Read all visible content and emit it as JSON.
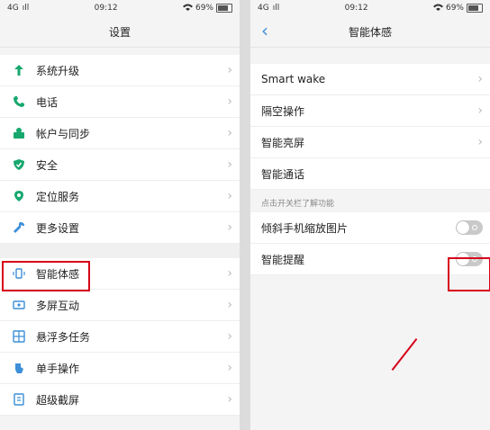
{
  "left": {
    "status": {
      "network": "4G",
      "signal": "ıll",
      "time": "09:12",
      "battery": "69%"
    },
    "title": "设置",
    "group1": [
      {
        "label": "系统升级",
        "icon": "arrow-up-icon"
      },
      {
        "label": "电话",
        "icon": "phone-icon"
      },
      {
        "label": "帐户与同步",
        "icon": "account-sync-icon"
      },
      {
        "label": "安全",
        "icon": "shield-icon"
      },
      {
        "label": "定位服务",
        "icon": "location-pin-icon"
      },
      {
        "label": "更多设置",
        "icon": "wrench-icon"
      }
    ],
    "group2": [
      {
        "label": "智能体感",
        "icon": "smart-motion-icon"
      },
      {
        "label": "多屏互动",
        "icon": "multi-screen-icon"
      },
      {
        "label": "悬浮多任务",
        "icon": "floating-task-icon"
      },
      {
        "label": "单手操作",
        "icon": "one-hand-icon"
      },
      {
        "label": "超级截屏",
        "icon": "screenshot-icon"
      }
    ]
  },
  "right": {
    "status": {
      "network": "4G",
      "signal": "ıll",
      "time": "09:12",
      "battery": "69%"
    },
    "title": "智能体感",
    "items": [
      {
        "label": "Smart wake"
      },
      {
        "label": "隔空操作"
      },
      {
        "label": "智能亮屏"
      },
      {
        "label": "智能通话"
      }
    ],
    "section_label": "点击开关栏了解功能",
    "toggles": [
      {
        "label": "倾斜手机缩放图片",
        "state": "off"
      },
      {
        "label": "智能提醒",
        "state": "off"
      }
    ]
  },
  "colors": {
    "accent": "#3c8fd8",
    "green_icon": "#17a86e",
    "highlight": "#d7001a"
  }
}
